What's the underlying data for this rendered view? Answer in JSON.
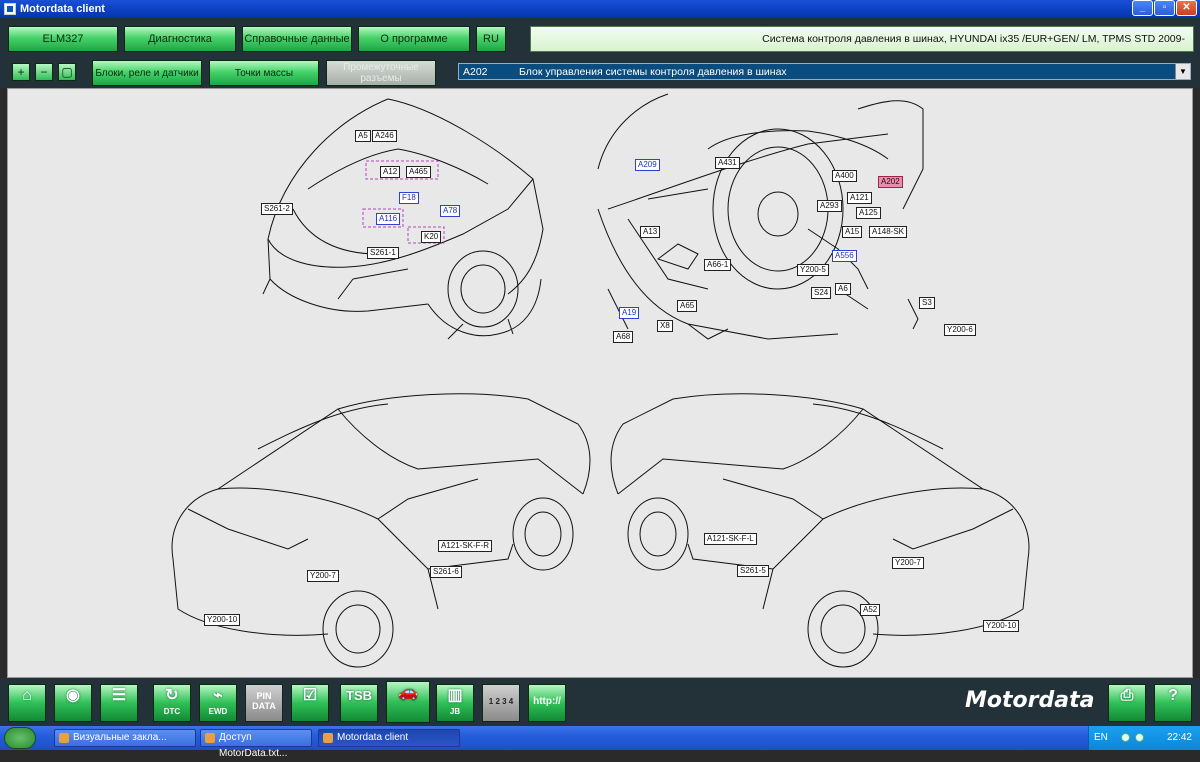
{
  "window": {
    "title": "Motordata client"
  },
  "top_tabs": [
    {
      "label": "ELM327"
    },
    {
      "label": "Диагностика"
    },
    {
      "label": "Справочные данные"
    },
    {
      "label": "О программе"
    },
    {
      "label": "RU"
    }
  ],
  "top_status": "Система контроля давления в шинах, HYUNDAI  ix35 /EUR+GEN/  LM,    TPMS  STD  2009-",
  "sub_tabs": [
    {
      "label": "Блоки, реле и датчики"
    },
    {
      "label": "Точки массы"
    },
    {
      "label": "Промежуточные разъемы"
    }
  ],
  "component": {
    "code": "A202",
    "description": "Блок управления системы контроля давления в шинах"
  },
  "diagram_labels": {
    "engine_bay": [
      "A5",
      "A246",
      "A12",
      "A465",
      "F18",
      "A78",
      "A116",
      "K20",
      "S261-2",
      "S261-1"
    ],
    "interior": [
      "A209",
      "A431",
      "A400",
      "A202",
      "A121",
      "A293",
      "A125",
      "A15",
      "A148-SK",
      "A13",
      "A556",
      "A66-1",
      "Y200-5",
      "S24",
      "A6",
      "S3",
      "A19",
      "A65",
      "X8",
      "A68",
      "Y200-6"
    ],
    "rear_left": [
      "A121-SK-F-R",
      "S261-6",
      "Y200-7",
      "Y200-10"
    ],
    "rear_right": [
      "A121-SK-F-L",
      "S261-5",
      "Y200-7",
      "A52",
      "Y200-10"
    ]
  },
  "bottom_toolbar": [
    {
      "icon": "home-icon"
    },
    {
      "icon": "globe-icon"
    },
    {
      "icon": "document-icon"
    },
    {
      "icon": "dtc-icon",
      "caption": "DTC"
    },
    {
      "icon": "ewd-icon",
      "caption": "EWD"
    },
    {
      "icon": "pin-data-icon",
      "caption": "PIN DATA"
    },
    {
      "icon": "checklist-icon"
    },
    {
      "icon": "tsb-icon",
      "caption": "TSB"
    },
    {
      "icon": "car-location-icon"
    },
    {
      "icon": "junction-box-icon",
      "caption": "JB"
    },
    {
      "icon": "grid-1234-icon",
      "caption": "1 2 3 4"
    },
    {
      "icon": "http-icon",
      "caption": "http://"
    }
  ],
  "brand": "Motordata",
  "taskbar": {
    "items": [
      {
        "label": "Визуальные закла..."
      },
      {
        "label": "Доступ MotorData.txt..."
      },
      {
        "label": "Motordata client"
      }
    ],
    "language": "EN",
    "clock": "22:42"
  }
}
